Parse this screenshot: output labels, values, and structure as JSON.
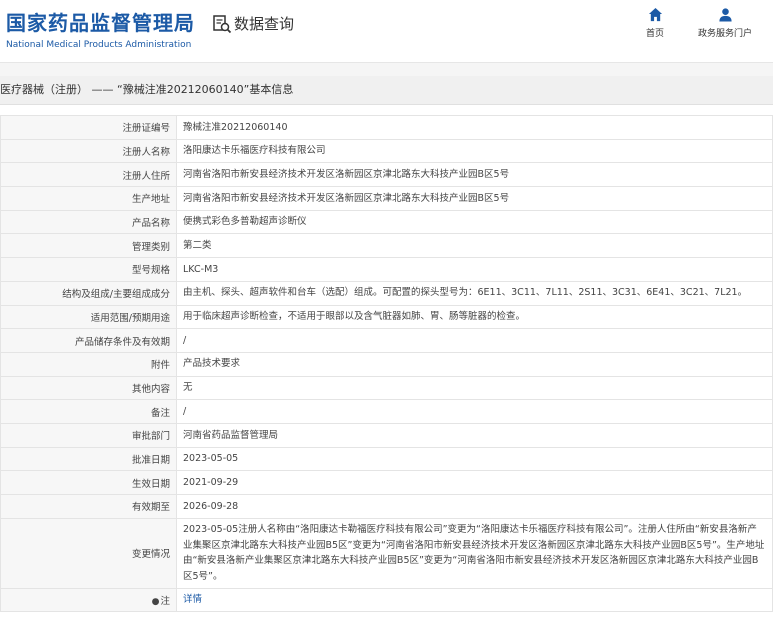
{
  "header": {
    "logo_cn": "国家药品监督管理局",
    "logo_en": "National Medical Products Administration",
    "search_title": "数据查询",
    "nav": [
      {
        "label": "首页",
        "icon": "home-icon"
      },
      {
        "label": "政务服务门户",
        "icon": "user-icon"
      }
    ]
  },
  "breadcrumb": "医疗器械（注册） —— “豫械注准20212060140”基本信息",
  "rows": [
    {
      "key": "注册证编号",
      "value": "豫械注准20212060140"
    },
    {
      "key": "注册人名称",
      "value": "洛阳康达卡乐福医疗科技有限公司"
    },
    {
      "key": "注册人住所",
      "value": "河南省洛阳市新安县经济技术开发区洛新园区京津北路东大科技产业园B区5号"
    },
    {
      "key": "生产地址",
      "value": "河南省洛阳市新安县经济技术开发区洛新园区京津北路东大科技产业园B区5号"
    },
    {
      "key": "产品名称",
      "value": "便携式彩色多普勒超声诊断仪"
    },
    {
      "key": "管理类别",
      "value": "第二类"
    },
    {
      "key": "型号规格",
      "value": "LKC-M3"
    },
    {
      "key": "结构及组成/主要组成成分",
      "value": "由主机、探头、超声软件和台车（选配）组成。可配置的探头型号为：6E11、3C11、7L11、2S11、3C31、6E41、3C21、7L21。"
    },
    {
      "key": "适用范围/预期用途",
      "value": "用于临床超声诊断检查，不适用于眼部以及含气脏器如肺、胃、肠等脏器的检查。"
    },
    {
      "key": "产品储存条件及有效期",
      "value": "/"
    },
    {
      "key": "附件",
      "value": "产品技术要求"
    },
    {
      "key": "其他内容",
      "value": "无"
    },
    {
      "key": "备注",
      "value": "/"
    },
    {
      "key": "审批部门",
      "value": "河南省药品监督管理局"
    },
    {
      "key": "批准日期",
      "value": "2023-05-05"
    },
    {
      "key": "生效日期",
      "value": "2021-09-29"
    },
    {
      "key": "有效期至",
      "value": "2026-09-28"
    },
    {
      "key": "变更情况",
      "value": "2023-05-05注册人名称由“洛阳康达卡勒福医疗科技有限公司”变更为“洛阳康达卡乐福医疗科技有限公司”。注册人住所由“新安县洛新产业集聚区京津北路东大科技产业园B5区”变更为“河南省洛阳市新安县经济技术开发区洛新园区京津北路东大科技产业园B区5号”。生产地址由“新安县洛新产业集聚区京津北路东大科技产业园B5区”变更为“河南省洛阳市新安县经济技术开发区洛新园区京津北路东大科技产业园B区5号”。"
    }
  ],
  "note": {
    "key": "注",
    "link": "详情"
  }
}
